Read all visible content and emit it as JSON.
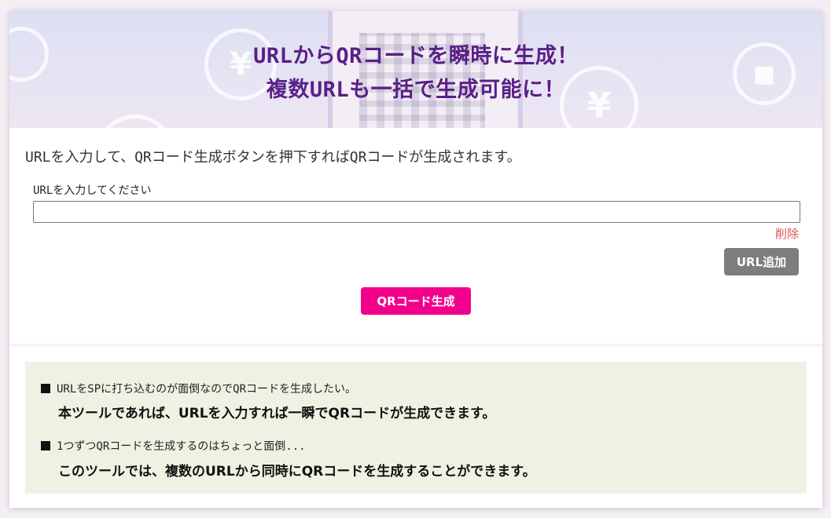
{
  "hero": {
    "title_line1": "URLからQRコードを瞬時に生成！",
    "title_line2": "複数URLも一括で生成可能に！",
    "deco_yen": "¥"
  },
  "main": {
    "intro": "URLを入力して、QRコード生成ボタンを押下すればQRコードが生成されます。",
    "url_label": "URLを入力してください",
    "url_value": "",
    "url_placeholder": "",
    "delete_label": "削除",
    "add_url_label": "URL追加",
    "generate_label": "QRコード生成"
  },
  "faq": [
    {
      "question": "URLをSPに打ち込むのが面倒なのでQRコードを生成したい。",
      "answer": "本ツールであれば、URLを入力すれば一瞬でQRコードが生成できます。"
    },
    {
      "question": "1つずつQRコードを生成するのはちょっと面倒...",
      "answer": "このツールでは、複数のURLから同時にQRコードを生成することができます。"
    }
  ],
  "colors": {
    "title": "#5a1f86",
    "generate_button": "#f2008c",
    "add_button": "#7d7d7d",
    "delete_link": "#d9534f",
    "faq_background": "#f0f1e2"
  }
}
